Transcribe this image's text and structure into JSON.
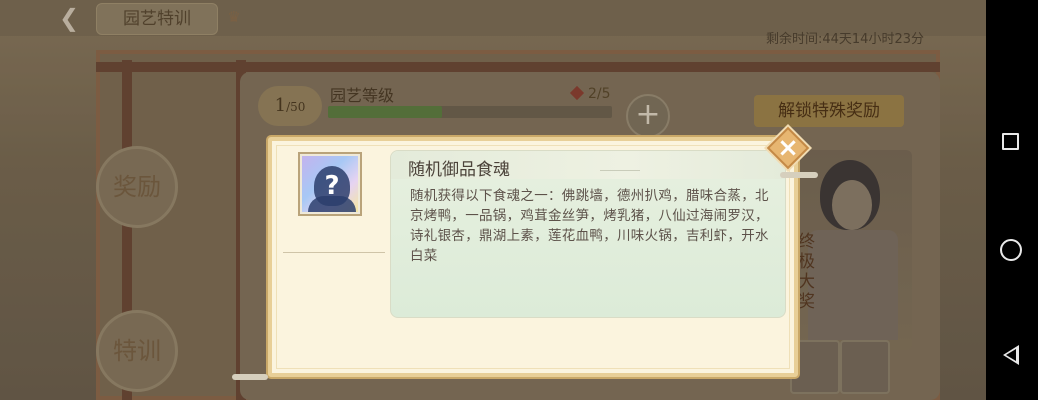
{
  "header": {
    "back_icon": "back-arrow-icon",
    "title": "园艺特训",
    "crown_icon": "crown-icon",
    "remaining_time": "剩余时间:44天14小时23分"
  },
  "background": {
    "level_badge_value": "1",
    "level_badge_max": "/50",
    "level_label": "园艺等级",
    "progress_text": "2/5",
    "progress_fraction": 0.4,
    "reward_label": "奖励",
    "training_label": "特训",
    "unlock_banner": "解锁特殊奖励",
    "vertical_text": "终极大奖"
  },
  "modal": {
    "item_name": "随机御品食魂",
    "item_icon": "mystery-question-icon",
    "item_question": "?",
    "description": "随机获得以下食魂之一：佛跳墙，德州扒鸡，腊味合蒸，北京烤鸭，一品锅，鸡茸金丝笋，烤乳猪，八仙过海闹罗汉，诗礼银杏，鼎湖上素，莲花血鸭，川味火锅，吉利虾，开水白菜",
    "close_label": "×"
  },
  "colors": {
    "modal_bg": "#fbf4de",
    "modal_border": "#e8cf97",
    "desc_panel_bg": "#e1eedb",
    "close_button": "#e7b671"
  },
  "navbar": {
    "recents_icon": "square-recents-icon",
    "home_icon": "circle-home-icon",
    "back_icon": "triangle-back-icon"
  }
}
